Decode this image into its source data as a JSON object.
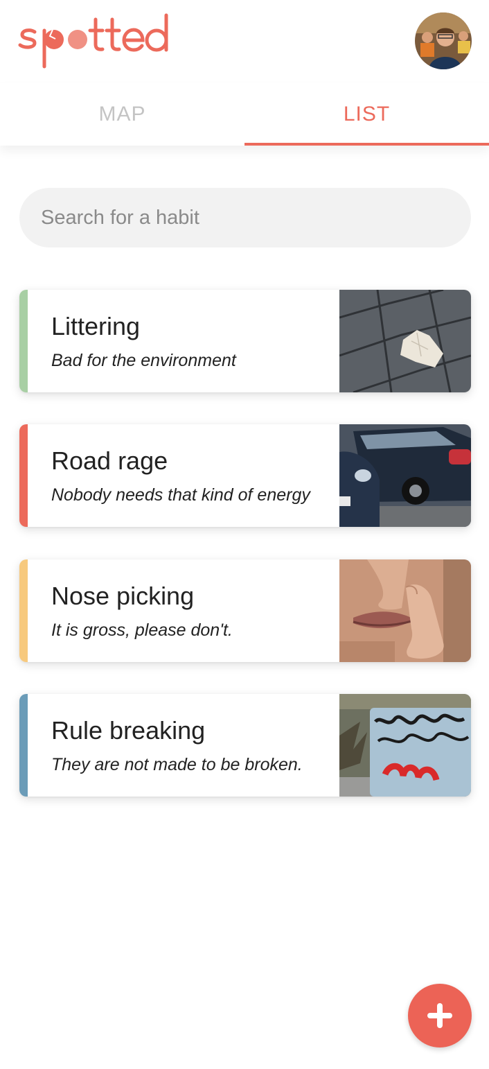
{
  "app": {
    "logo_text": "spotted",
    "accent_color": "#ec6a5b"
  },
  "header": {
    "avatar_alt": "user-avatar"
  },
  "tabs": [
    {
      "label": "MAP",
      "active": false
    },
    {
      "label": "LIST",
      "active": true
    }
  ],
  "search": {
    "placeholder": "Search for a habit",
    "value": ""
  },
  "habits": [
    {
      "title": "Littering",
      "description": "Bad for the environment",
      "color": "#a8cfa4",
      "thumbnail": "crumpled-paper-on-pavement"
    },
    {
      "title": "Road rage",
      "description": "Nobody needs that kind of energy",
      "color": "#ec6a5b",
      "thumbnail": "parked-cars"
    },
    {
      "title": "Nose picking",
      "description": "It is gross, please don't.",
      "color": "#f7c97d",
      "thumbnail": "finger-in-nose"
    },
    {
      "title": "Rule breaking",
      "description": "They are not made to be broken.",
      "color": "#6b9cb8",
      "thumbnail": "graffiti-box"
    }
  ],
  "fab": {
    "icon": "plus-icon"
  }
}
